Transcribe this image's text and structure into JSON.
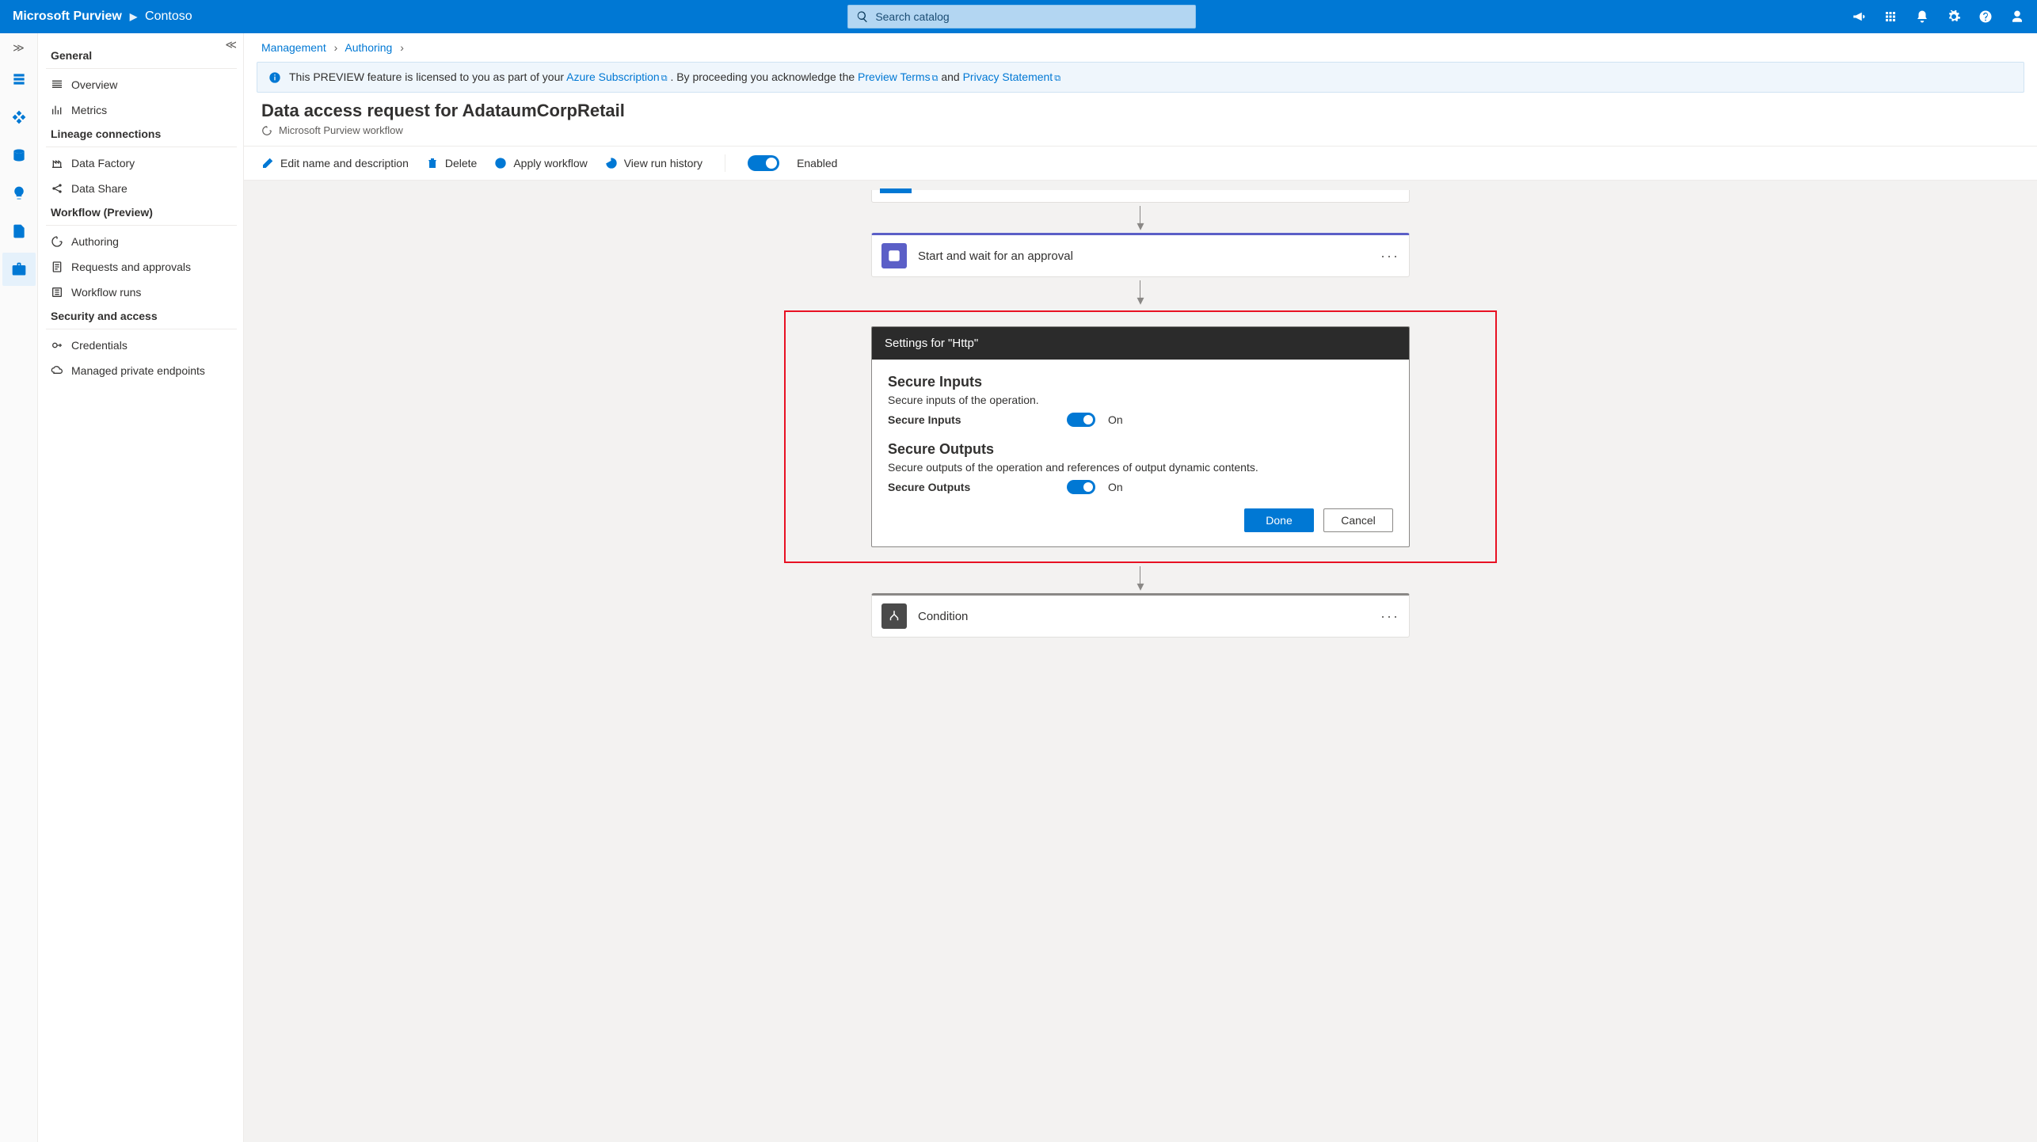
{
  "brand": {
    "product": "Microsoft Purview",
    "tenant": "Contoso"
  },
  "search": {
    "placeholder": "Search catalog"
  },
  "sidebar": {
    "groups": [
      {
        "title": "General",
        "items": [
          {
            "label": "Overview"
          },
          {
            "label": "Metrics"
          }
        ]
      },
      {
        "title": "Lineage connections",
        "items": [
          {
            "label": "Data Factory"
          },
          {
            "label": "Data Share"
          }
        ]
      },
      {
        "title": "Workflow (Preview)",
        "items": [
          {
            "label": "Authoring"
          },
          {
            "label": "Requests and approvals"
          },
          {
            "label": "Workflow runs"
          }
        ]
      },
      {
        "title": "Security and access",
        "items": [
          {
            "label": "Credentials"
          },
          {
            "label": "Managed private endpoints"
          }
        ]
      }
    ]
  },
  "breadcrumb": {
    "a": "Management",
    "b": "Authoring"
  },
  "banner": {
    "pre": "This PREVIEW feature is licensed to you as part of your ",
    "link1": "Azure Subscription",
    "mid": ". By proceeding you acknowledge the ",
    "link2": "Preview Terms",
    "and": " and ",
    "link3": "Privacy Statement"
  },
  "page": {
    "title": "Data access request for AdataumCorpRetail",
    "subtitle": "Microsoft Purview workflow"
  },
  "toolbar": {
    "edit": "Edit name and description",
    "delete": "Delete",
    "apply": "Apply workflow",
    "history": "View run history",
    "enabled_label": "Enabled"
  },
  "flow": {
    "approval_title": "Start and wait for an approval",
    "condition_title": "Condition",
    "settings_header": "Settings for \"Http\"",
    "secure_inputs_title": "Secure Inputs",
    "secure_inputs_desc": "Secure inputs of the operation.",
    "secure_inputs_label": "Secure Inputs",
    "secure_inputs_state": "On",
    "secure_outputs_title": "Secure Outputs",
    "secure_outputs_desc": "Secure outputs of the operation and references of output dynamic contents.",
    "secure_outputs_label": "Secure Outputs",
    "secure_outputs_state": "On",
    "done": "Done",
    "cancel": "Cancel"
  }
}
